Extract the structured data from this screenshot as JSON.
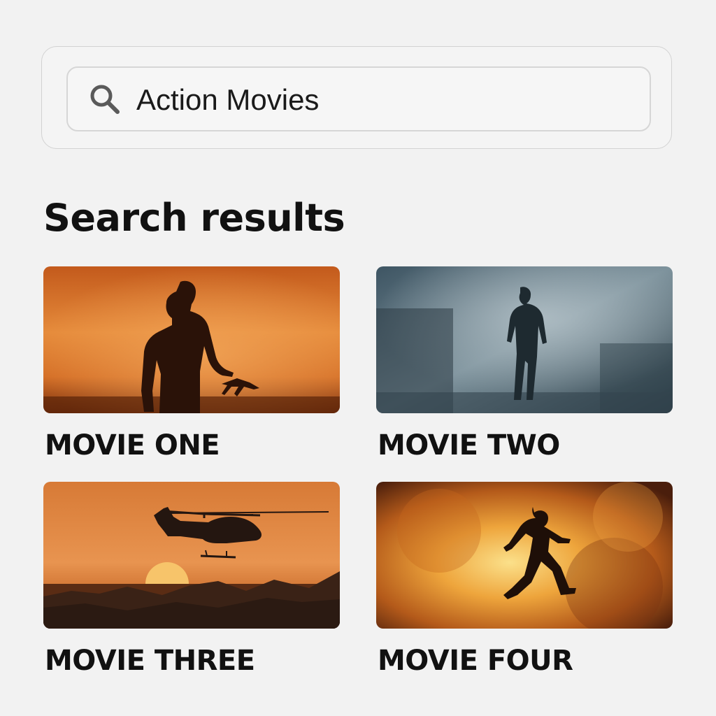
{
  "search": {
    "value": "Action Movies",
    "icon": "search-icon"
  },
  "results_heading": "Search results",
  "results": [
    {
      "title": "MOVIE ONE"
    },
    {
      "title": "MOVIE TWO"
    },
    {
      "title": "MOVIE THREE"
    },
    {
      "title": "MOVIE FOUR"
    }
  ]
}
